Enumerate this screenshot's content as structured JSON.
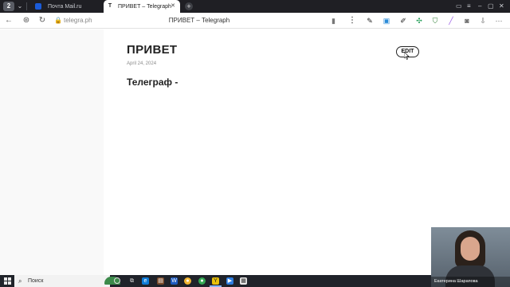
{
  "browser": {
    "profile_badge": "2",
    "tabs": [
      {
        "title": "Почта Mail.ru",
        "active": false,
        "favicon": "mail-ru-icon"
      },
      {
        "title": "ПРИВЕТ – Telegraph",
        "active": true,
        "favicon": "telegraph-icon",
        "favicon_glyph": "T"
      }
    ],
    "address_bar": {
      "url": "telegra.ph",
      "page_title": "ПРИВЕТ – Telegraph"
    }
  },
  "article": {
    "title": "ПРИВЕТ",
    "date": "April 24, 2024",
    "body": "Телеграф -",
    "edit_label": "EDIT"
  },
  "webcam": {
    "caption": "Екатерина Шарапова"
  },
  "taskbar": {
    "search_placeholder": "Поиск"
  },
  "colors": {
    "tab_strip": "#1f1f24",
    "taskbar": "#20232a",
    "page_background": "#ffffff"
  }
}
